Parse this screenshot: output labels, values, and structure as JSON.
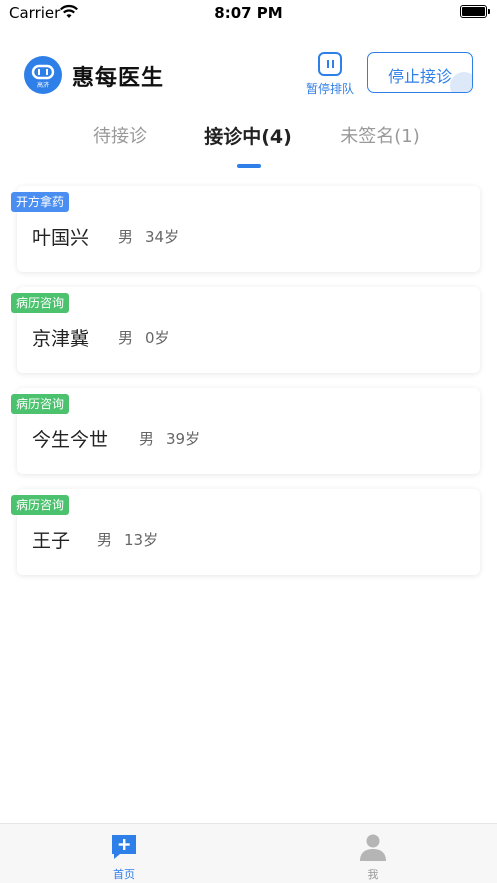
{
  "status_bar": {
    "carrier": "Carrier",
    "time": "8:07 PM"
  },
  "header": {
    "logo_text": "高济",
    "title": "惠每医生",
    "pause_label": "暂停排队",
    "stop_label": "停止接诊"
  },
  "tabs": [
    {
      "label": "待接诊",
      "active": false
    },
    {
      "label": "接诊中(4)",
      "active": true
    },
    {
      "label": "未签名(1)",
      "active": false
    }
  ],
  "patients": [
    {
      "tag": "开方拿药",
      "tag_color": "#4b8ef1",
      "name": "叶国兴",
      "gender": "男",
      "age": "34岁"
    },
    {
      "tag": "病历咨询",
      "tag_color": "#4cc26f",
      "name": "京津冀",
      "gender": "男",
      "age": "0岁"
    },
    {
      "tag": "病历咨询",
      "tag_color": "#4cc26f",
      "name": "今生今世",
      "gender": "男",
      "age": "39岁"
    },
    {
      "tag": "病历咨询",
      "tag_color": "#4cc26f",
      "name": "王子",
      "gender": "男",
      "age": "13岁"
    }
  ],
  "tabbar": [
    {
      "label": "首页",
      "icon": "chat-plus-icon",
      "active": true
    },
    {
      "label": "我",
      "icon": "person-icon",
      "active": false
    }
  ],
  "colors": {
    "accent": "#2f7fe8",
    "tag_blue": "#4b8ef1",
    "tag_green": "#4cc26f"
  }
}
